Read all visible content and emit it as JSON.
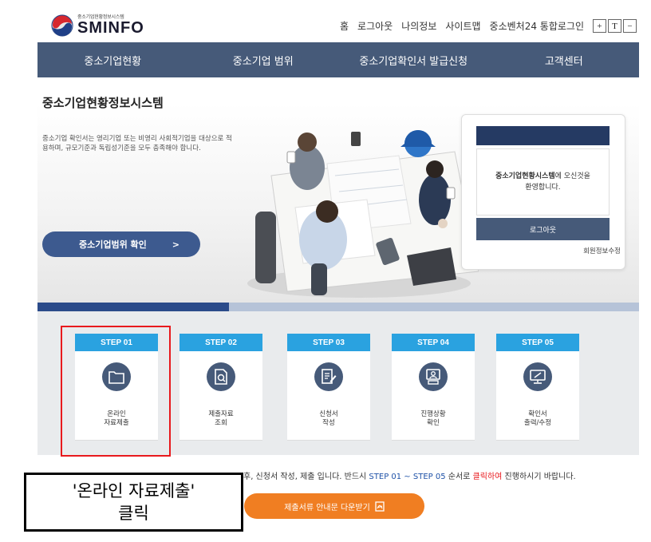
{
  "header": {
    "logo_small": "중소기업현황정보시스템",
    "logo_main": "SMINFO",
    "util_links": [
      "홈",
      "로그아웃",
      "나의정보",
      "사이트맵",
      "중소벤처24 통합로그인"
    ],
    "font_controls": [
      "+",
      "T",
      "−"
    ]
  },
  "gnb": {
    "items": [
      "중소기업현황",
      "중소기업 범위",
      "중소기업확인서 발급신청",
      "고객센터"
    ]
  },
  "page": {
    "title": "중소기업현황정보시스템"
  },
  "hero": {
    "description": "중소기업 확인서는 영리기업 또는 비영리 사회적기업을 대상으로 적용하며, 규모기준과 독립성기준을 모두 충족해야 합니다.",
    "button_label": "중소기업범위 확인",
    "button_arrow": ">"
  },
  "login": {
    "welcome_bold": "중소기업현황시스템",
    "welcome_rest": "에 오신것을",
    "welcome_line2": "환영합니다.",
    "logout_label": "로그아웃",
    "member_edit_label": "회원정보수정"
  },
  "steps": [
    {
      "tab": "STEP 01",
      "label": "온라인\n자료제출",
      "icon": "folder-icon"
    },
    {
      "tab": "STEP 02",
      "label": "제출자료\n조회",
      "icon": "document-search-icon"
    },
    {
      "tab": "STEP 03",
      "label": "신청서\n작성",
      "icon": "edit-document-icon"
    },
    {
      "tab": "STEP 04",
      "label": "진행상황\n확인",
      "icon": "person-monitor-icon"
    },
    {
      "tab": "STEP 05",
      "label": "확인서\n출력/수정",
      "icon": "print-monitor-icon"
    }
  ],
  "info": {
    "text_a": "후, 신청서 작성, 제출 입니다. 반드시 ",
    "text_blue": "STEP 01 ~ STEP 05",
    "text_b": " 순서로 ",
    "text_red": "클릭하여",
    "text_c": " 진행하시기 바랍니다.",
    "download_label": "제출서류 안내문 다운받기"
  },
  "callout": {
    "line1": "'온라인 자료제출'",
    "line2": "클릭"
  },
  "colors": {
    "nav": "#465a79",
    "step_tab": "#2aa2e0",
    "highlight": "#e8191d",
    "download": "#f07e22",
    "accent_blue": "#1f52a8"
  }
}
